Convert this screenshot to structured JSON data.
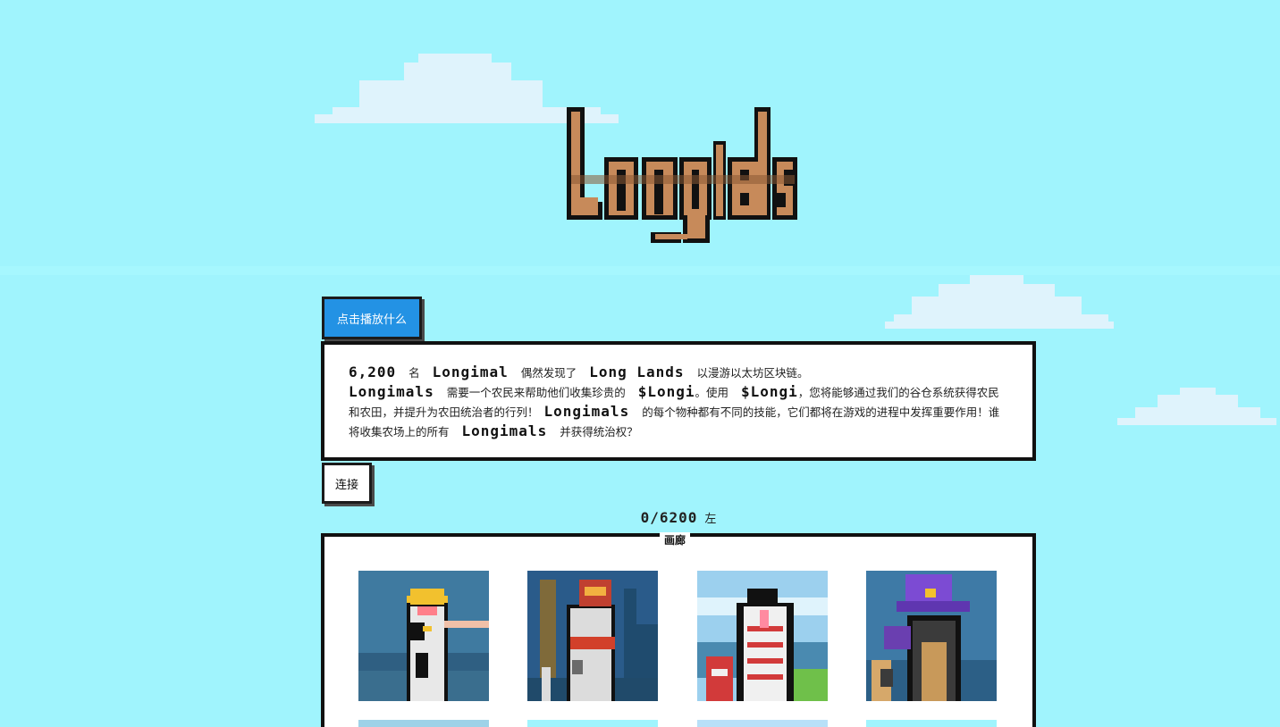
{
  "header": {
    "logo_text": "Longimals"
  },
  "actions": {
    "play_label": "点击播放什么",
    "connect_label": "连接"
  },
  "story": {
    "count": "6,200",
    "w1": "名",
    "name1": "Longimal",
    "w2": "偶然发现了",
    "lands": "Long Lands",
    "w3": "以漫游以太坊区块链。",
    "name2": "Longimals",
    "w4": "需要一个农民来帮助他们收集珍贵的",
    "token1": "$Longi",
    "w5": "。使用",
    "token2": "$Longi",
    "w6": "，您将能够通过我们的谷仓系统获得农民和农田，并提升为农田统治者的行列！",
    "name3": "Longimals",
    "w7": "的每个物种都有不同的技能，它们都将在游戏的进程中发挥重要作用！谁将收集农场上的所有",
    "name4": "Longimals",
    "w8": "并获得统治权？"
  },
  "counter": {
    "value": "0/6200",
    "suffix": "左"
  },
  "gallery": {
    "label": "画廊",
    "items": [
      {
        "name": "cat-king",
        "bg": "#3f7aa0",
        "body": "#e8e8e8",
        "accent": "#f2c12e"
      },
      {
        "name": "cat-farmer",
        "bg": "#2a5b8a",
        "body": "#dcdcdc",
        "accent": "#d2402a"
      },
      {
        "name": "snake",
        "bg": "#9cd0ee",
        "body": "#f0f0f0",
        "accent": "#d23a3a"
      },
      {
        "name": "wizard",
        "bg": "#3e7aa6",
        "body": "#3b3b3b",
        "accent": "#7c4bd3"
      }
    ],
    "row2_colors": [
      "#9ed2e8",
      "#a0f4fd",
      "#b8e0f8",
      "#a0f4fd"
    ]
  },
  "colors": {
    "sky": "#a0f4fd",
    "cloud": "#dff3fc",
    "button_blue": "#2392e4",
    "logo_fill": "#c78a5a"
  }
}
